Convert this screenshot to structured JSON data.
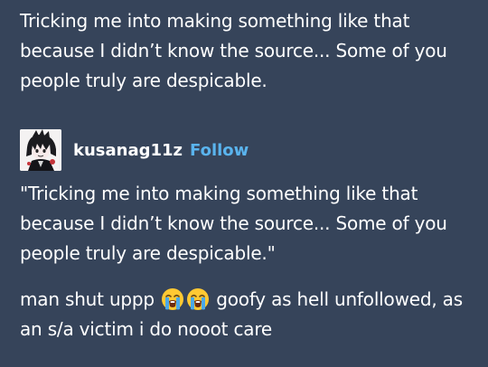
{
  "post": {
    "body_text": "Tricking me into making something like that because I didn’t know the source... Some of you people truly are despicable."
  },
  "reblog": {
    "username": "kusanag11z",
    "follow_label": "Follow",
    "quote_text": "\"Tricking me into making something like that because I didn’t know the source... Some of you people truly are despicable.\""
  },
  "reply": {
    "text_before": "man shut uppp",
    "emoji_1": "loudly-crying-face-icon",
    "emoji_2": "loudly-crying-face-icon",
    "text_after": "goofy as hell unfollowed, as an s/a victim i do nooot care"
  },
  "colors": {
    "background": "#36445a",
    "text": "#ffffff",
    "follow_link": "#5ab4ee"
  }
}
